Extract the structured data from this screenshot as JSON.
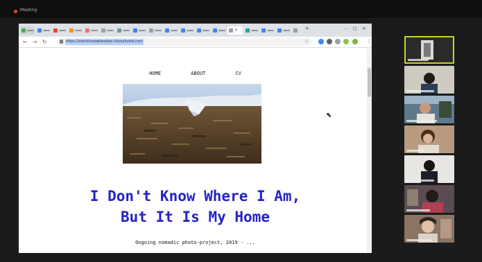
{
  "app": {
    "title": "Meeting"
  },
  "browser": {
    "url": "https://irdonthowwhereiam.itismyhome.com"
  },
  "site": {
    "nav": [
      "HOME",
      "ABOUT",
      "CV"
    ],
    "headline_line1": "I Don't Know Where I Am,",
    "headline_line2": "But It Is My Home",
    "subline": "Ongoing nomadic photo-project, 2019 - ..."
  },
  "colors": {
    "headline": "#2323c8",
    "active_speaker_border": "#c7d52a"
  },
  "participants": [
    {
      "name": "",
      "active": true
    },
    {
      "name": ""
    },
    {
      "name": ""
    },
    {
      "name": ""
    },
    {
      "name": ""
    },
    {
      "name": ""
    },
    {
      "name": ""
    }
  ]
}
